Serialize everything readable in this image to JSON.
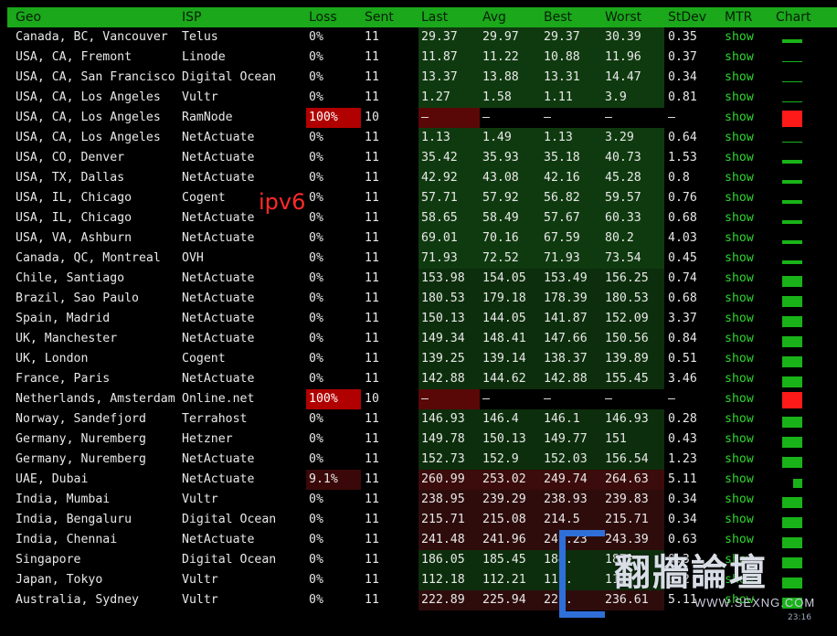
{
  "headers": {
    "geo": "Geo",
    "isp": "ISP",
    "loss": "Loss",
    "sent": "Sent",
    "last": "Last",
    "avg": "Avg",
    "best": "Best",
    "worst": "Worst",
    "stdev": "StDev",
    "mtr": "MTR",
    "chart": "Chart"
  },
  "annotation": "ipv6",
  "watermark": {
    "text": "翻牆論壇",
    "url": "WWW.SEXNG.COM",
    "time": "23:16"
  },
  "colors": {
    "header": "#1ba81b",
    "loss_red": "#b10000",
    "mtr_link": "#2ed82e",
    "chart_green": "#19b319",
    "chart_red": "#ff1a1a"
  },
  "rows": [
    {
      "geo": "Canada, BC, Vancouver",
      "isp": "Telus",
      "loss": "0%",
      "sent": "11",
      "last": "29.37",
      "avg": "29.97",
      "best": "29.37",
      "worst": "30.39",
      "stdev": "0.35",
      "mtr": "show",
      "tone": "green1",
      "chart": "bar-small"
    },
    {
      "geo": "USA, CA, Fremont",
      "isp": "Linode",
      "loss": "0%",
      "sent": "11",
      "last": "11.87",
      "avg": "11.22",
      "best": "10.88",
      "worst": "11.96",
      "stdev": "0.37",
      "mtr": "show",
      "tone": "green1",
      "chart": "line"
    },
    {
      "geo": "USA, CA, San Francisco",
      "isp": "Digital Ocean",
      "loss": "0%",
      "sent": "11",
      "last": "13.37",
      "avg": "13.88",
      "best": "13.31",
      "worst": "14.47",
      "stdev": "0.34",
      "mtr": "show",
      "tone": "green1",
      "chart": "line"
    },
    {
      "geo": "USA, CA, Los Angeles",
      "isp": "Vultr",
      "loss": "0%",
      "sent": "11",
      "last": "1.27",
      "avg": "1.58",
      "best": "1.11",
      "worst": "3.9",
      "stdev": "0.81",
      "mtr": "show",
      "tone": "green1",
      "chart": "line"
    },
    {
      "geo": "USA, CA, Los Angeles",
      "isp": "RamNode",
      "loss": "100%",
      "sent": "10",
      "last": "–",
      "avg": "–",
      "best": "–",
      "worst": "–",
      "stdev": "–",
      "mtr": "show",
      "tone": "dead",
      "chart": "red"
    },
    {
      "geo": "USA, CA, Los Angeles",
      "isp": "NetActuate",
      "loss": "0%",
      "sent": "11",
      "last": "1.13",
      "avg": "1.49",
      "best": "1.13",
      "worst": "3.29",
      "stdev": "0.64",
      "mtr": "show",
      "tone": "green1",
      "chart": "line"
    },
    {
      "geo": "USA, CO, Denver",
      "isp": "NetActuate",
      "loss": "0%",
      "sent": "11",
      "last": "35.42",
      "avg": "35.93",
      "best": "35.18",
      "worst": "40.73",
      "stdev": "1.53",
      "mtr": "show",
      "tone": "green1",
      "chart": "bar-small"
    },
    {
      "geo": "USA, TX, Dallas",
      "isp": "NetActuate",
      "loss": "0%",
      "sent": "11",
      "last": "42.92",
      "avg": "43.08",
      "best": "42.16",
      "worst": "45.28",
      "stdev": "0.8",
      "mtr": "show",
      "tone": "green1",
      "chart": "bar-small"
    },
    {
      "geo": "USA, IL, Chicago",
      "isp": "Cogent",
      "loss": "0%",
      "sent": "11",
      "last": "57.71",
      "avg": "57.92",
      "best": "56.82",
      "worst": "59.57",
      "stdev": "0.76",
      "mtr": "show",
      "tone": "green1",
      "chart": "bar-small"
    },
    {
      "geo": "USA, IL, Chicago",
      "isp": "NetActuate",
      "loss": "0%",
      "sent": "11",
      "last": "58.65",
      "avg": "58.49",
      "best": "57.67",
      "worst": "60.33",
      "stdev": "0.68",
      "mtr": "show",
      "tone": "green1",
      "chart": "bar-small"
    },
    {
      "geo": "USA, VA, Ashburn",
      "isp": "NetActuate",
      "loss": "0%",
      "sent": "11",
      "last": "69.01",
      "avg": "70.16",
      "best": "67.59",
      "worst": "80.2",
      "stdev": "4.03",
      "mtr": "show",
      "tone": "green1",
      "chart": "bar-small"
    },
    {
      "geo": "Canada, QC, Montreal",
      "isp": "OVH",
      "loss": "0%",
      "sent": "11",
      "last": "71.93",
      "avg": "72.52",
      "best": "71.93",
      "worst": "73.54",
      "stdev": "0.45",
      "mtr": "show",
      "tone": "green1",
      "chart": "bar-small"
    },
    {
      "geo": "Chile, Santiago",
      "isp": "NetActuate",
      "loss": "0%",
      "sent": "11",
      "last": "153.98",
      "avg": "154.05",
      "best": "153.49",
      "worst": "156.25",
      "stdev": "0.74",
      "mtr": "show",
      "tone": "green2",
      "chart": "bar"
    },
    {
      "geo": "Brazil, Sao Paulo",
      "isp": "NetActuate",
      "loss": "0%",
      "sent": "11",
      "last": "180.53",
      "avg": "179.18",
      "best": "178.39",
      "worst": "180.53",
      "stdev": "0.68",
      "mtr": "show",
      "tone": "green2",
      "chart": "bar"
    },
    {
      "geo": "Spain, Madrid",
      "isp": "NetActuate",
      "loss": "0%",
      "sent": "11",
      "last": "150.13",
      "avg": "144.05",
      "best": "141.87",
      "worst": "152.09",
      "stdev": "3.37",
      "mtr": "show",
      "tone": "green2",
      "chart": "bar"
    },
    {
      "geo": "UK, Manchester",
      "isp": "NetActuate",
      "loss": "0%",
      "sent": "11",
      "last": "149.34",
      "avg": "148.41",
      "best": "147.66",
      "worst": "150.56",
      "stdev": "0.84",
      "mtr": "show",
      "tone": "green2",
      "chart": "bar"
    },
    {
      "geo": "UK, London",
      "isp": "Cogent",
      "loss": "0%",
      "sent": "11",
      "last": "139.25",
      "avg": "139.14",
      "best": "138.37",
      "worst": "139.89",
      "stdev": "0.51",
      "mtr": "show",
      "tone": "green2",
      "chart": "bar"
    },
    {
      "geo": "France, Paris",
      "isp": "NetActuate",
      "loss": "0%",
      "sent": "11",
      "last": "142.88",
      "avg": "144.62",
      "best": "142.88",
      "worst": "155.45",
      "stdev": "3.46",
      "mtr": "show",
      "tone": "green2",
      "chart": "bar"
    },
    {
      "geo": "Netherlands, Amsterdam",
      "isp": "Online.net",
      "loss": "100%",
      "sent": "10",
      "last": "–",
      "avg": "–",
      "best": "–",
      "worst": "–",
      "stdev": "–",
      "mtr": "show",
      "tone": "dead",
      "chart": "red"
    },
    {
      "geo": "Norway, Sandefjord",
      "isp": "Terrahost",
      "loss": "0%",
      "sent": "11",
      "last": "146.93",
      "avg": "146.4",
      "best": "146.1",
      "worst": "146.93",
      "stdev": "0.28",
      "mtr": "show",
      "tone": "green2",
      "chart": "bar"
    },
    {
      "geo": "Germany, Nuremberg",
      "isp": "Hetzner",
      "loss": "0%",
      "sent": "11",
      "last": "149.78",
      "avg": "150.13",
      "best": "149.77",
      "worst": "151",
      "stdev": "0.43",
      "mtr": "show",
      "tone": "green2",
      "chart": "bar"
    },
    {
      "geo": "Germany, Nuremberg",
      "isp": "NetActuate",
      "loss": "0%",
      "sent": "11",
      "last": "152.73",
      "avg": "152.9",
      "best": "152.03",
      "worst": "156.54",
      "stdev": "1.23",
      "mtr": "show",
      "tone": "green2",
      "chart": "bar"
    },
    {
      "geo": "UAE, Dubai",
      "isp": "NetActuate",
      "loss": "9.1%",
      "sent": "11",
      "last": "260.99",
      "avg": "253.02",
      "best": "249.74",
      "worst": "264.63",
      "stdev": "5.11",
      "mtr": "show",
      "tone": "red2",
      "chart": "partial"
    },
    {
      "geo": "India, Mumbai",
      "isp": "Vultr",
      "loss": "0%",
      "sent": "11",
      "last": "238.95",
      "avg": "239.29",
      "best": "238.93",
      "worst": "239.83",
      "stdev": "0.34",
      "mtr": "show",
      "tone": "red1",
      "chart": "bar"
    },
    {
      "geo": "India, Bengaluru",
      "isp": "Digital Ocean",
      "loss": "0%",
      "sent": "11",
      "last": "215.71",
      "avg": "215.08",
      "best": "214.5",
      "worst": "215.71",
      "stdev": "0.34",
      "mtr": "show",
      "tone": "red1",
      "chart": "bar"
    },
    {
      "geo": "India, Chennai",
      "isp": "NetActuate",
      "loss": "0%",
      "sent": "11",
      "last": "241.48",
      "avg": "241.96",
      "best": "241.23",
      "worst": "243.39",
      "stdev": "0.63",
      "mtr": "show",
      "tone": "red1",
      "chart": "bar"
    },
    {
      "geo": "Singapore",
      "isp": "Digital Ocean",
      "loss": "0%",
      "sent": "11",
      "last": "186.05",
      "avg": "185.45",
      "best": "184.",
      "worst": "187.",
      "stdev": "0.3",
      "mtr": "show",
      "tone": "green2",
      "chart": "bar"
    },
    {
      "geo": "Japan, Tokyo",
      "isp": "Vultr",
      "loss": "0%",
      "sent": "11",
      "last": "112.18",
      "avg": "112.21",
      "best": "111.",
      "worst": "112.",
      "stdev": "0.2",
      "mtr": "show",
      "tone": "green2",
      "chart": "bar"
    },
    {
      "geo": "Australia, Sydney",
      "isp": "Vultr",
      "loss": "0%",
      "sent": "11",
      "last": "222.89",
      "avg": "225.94",
      "best": "221.",
      "worst": "236.61",
      "stdev": "5.11",
      "mtr": "show",
      "tone": "red1",
      "chart": "bar"
    }
  ]
}
